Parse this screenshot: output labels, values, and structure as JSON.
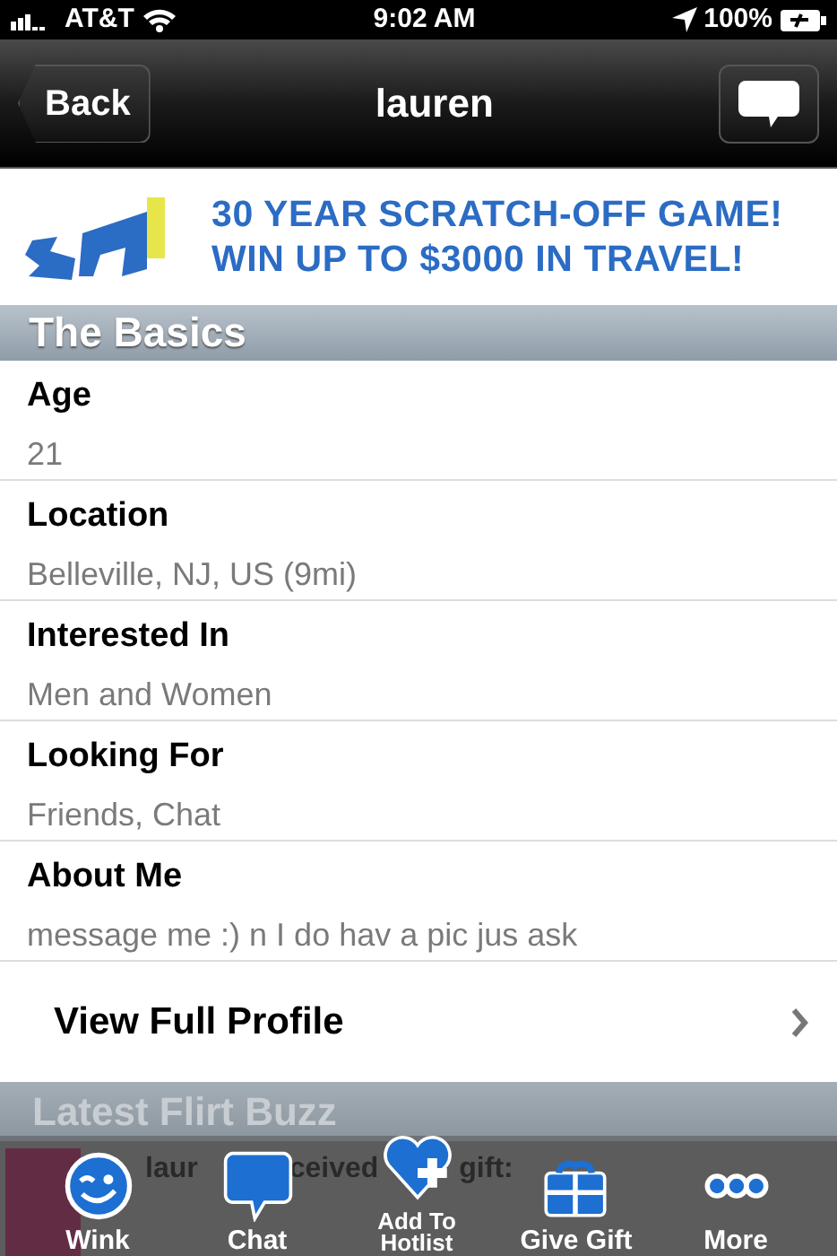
{
  "status_bar": {
    "carrier": "AT&T",
    "time": "9:02 AM",
    "battery": "100%"
  },
  "nav": {
    "back": "Back",
    "title": "lauren"
  },
  "banner": {
    "line_1": "30 YEAR SCRATCH-OFF GAME!",
    "line_2": "WIN UP TO $3000 IN TRAVEL!"
  },
  "sections": [
    {
      "title": "The Basics",
      "fields": [
        {
          "label": "Age",
          "value": "21"
        },
        {
          "label": "Location",
          "value": "Belleville, NJ, US (9mi)"
        },
        {
          "label": "Interested In",
          "value": "Men and Women"
        },
        {
          "label": "Looking For",
          "value": "Friends, Chat"
        },
        {
          "label": "About Me",
          "value": "message me :) n I do hav a pic jus ask"
        }
      ]
    }
  ],
  "view_full_profile": "View Full Profile",
  "buzz": {
    "title": "Latest Flirt Buzz",
    "fragments": [
      "laur",
      "ceived",
      "gift:"
    ]
  },
  "toolbar": [
    {
      "kind": "wink",
      "label": "Wink"
    },
    {
      "kind": "chat",
      "label": "Chat"
    },
    {
      "kind": "hotlist",
      "label": "Add To\nHotlist"
    },
    {
      "kind": "gift",
      "label": "Give Gift"
    },
    {
      "kind": "more",
      "label": "More"
    }
  ]
}
